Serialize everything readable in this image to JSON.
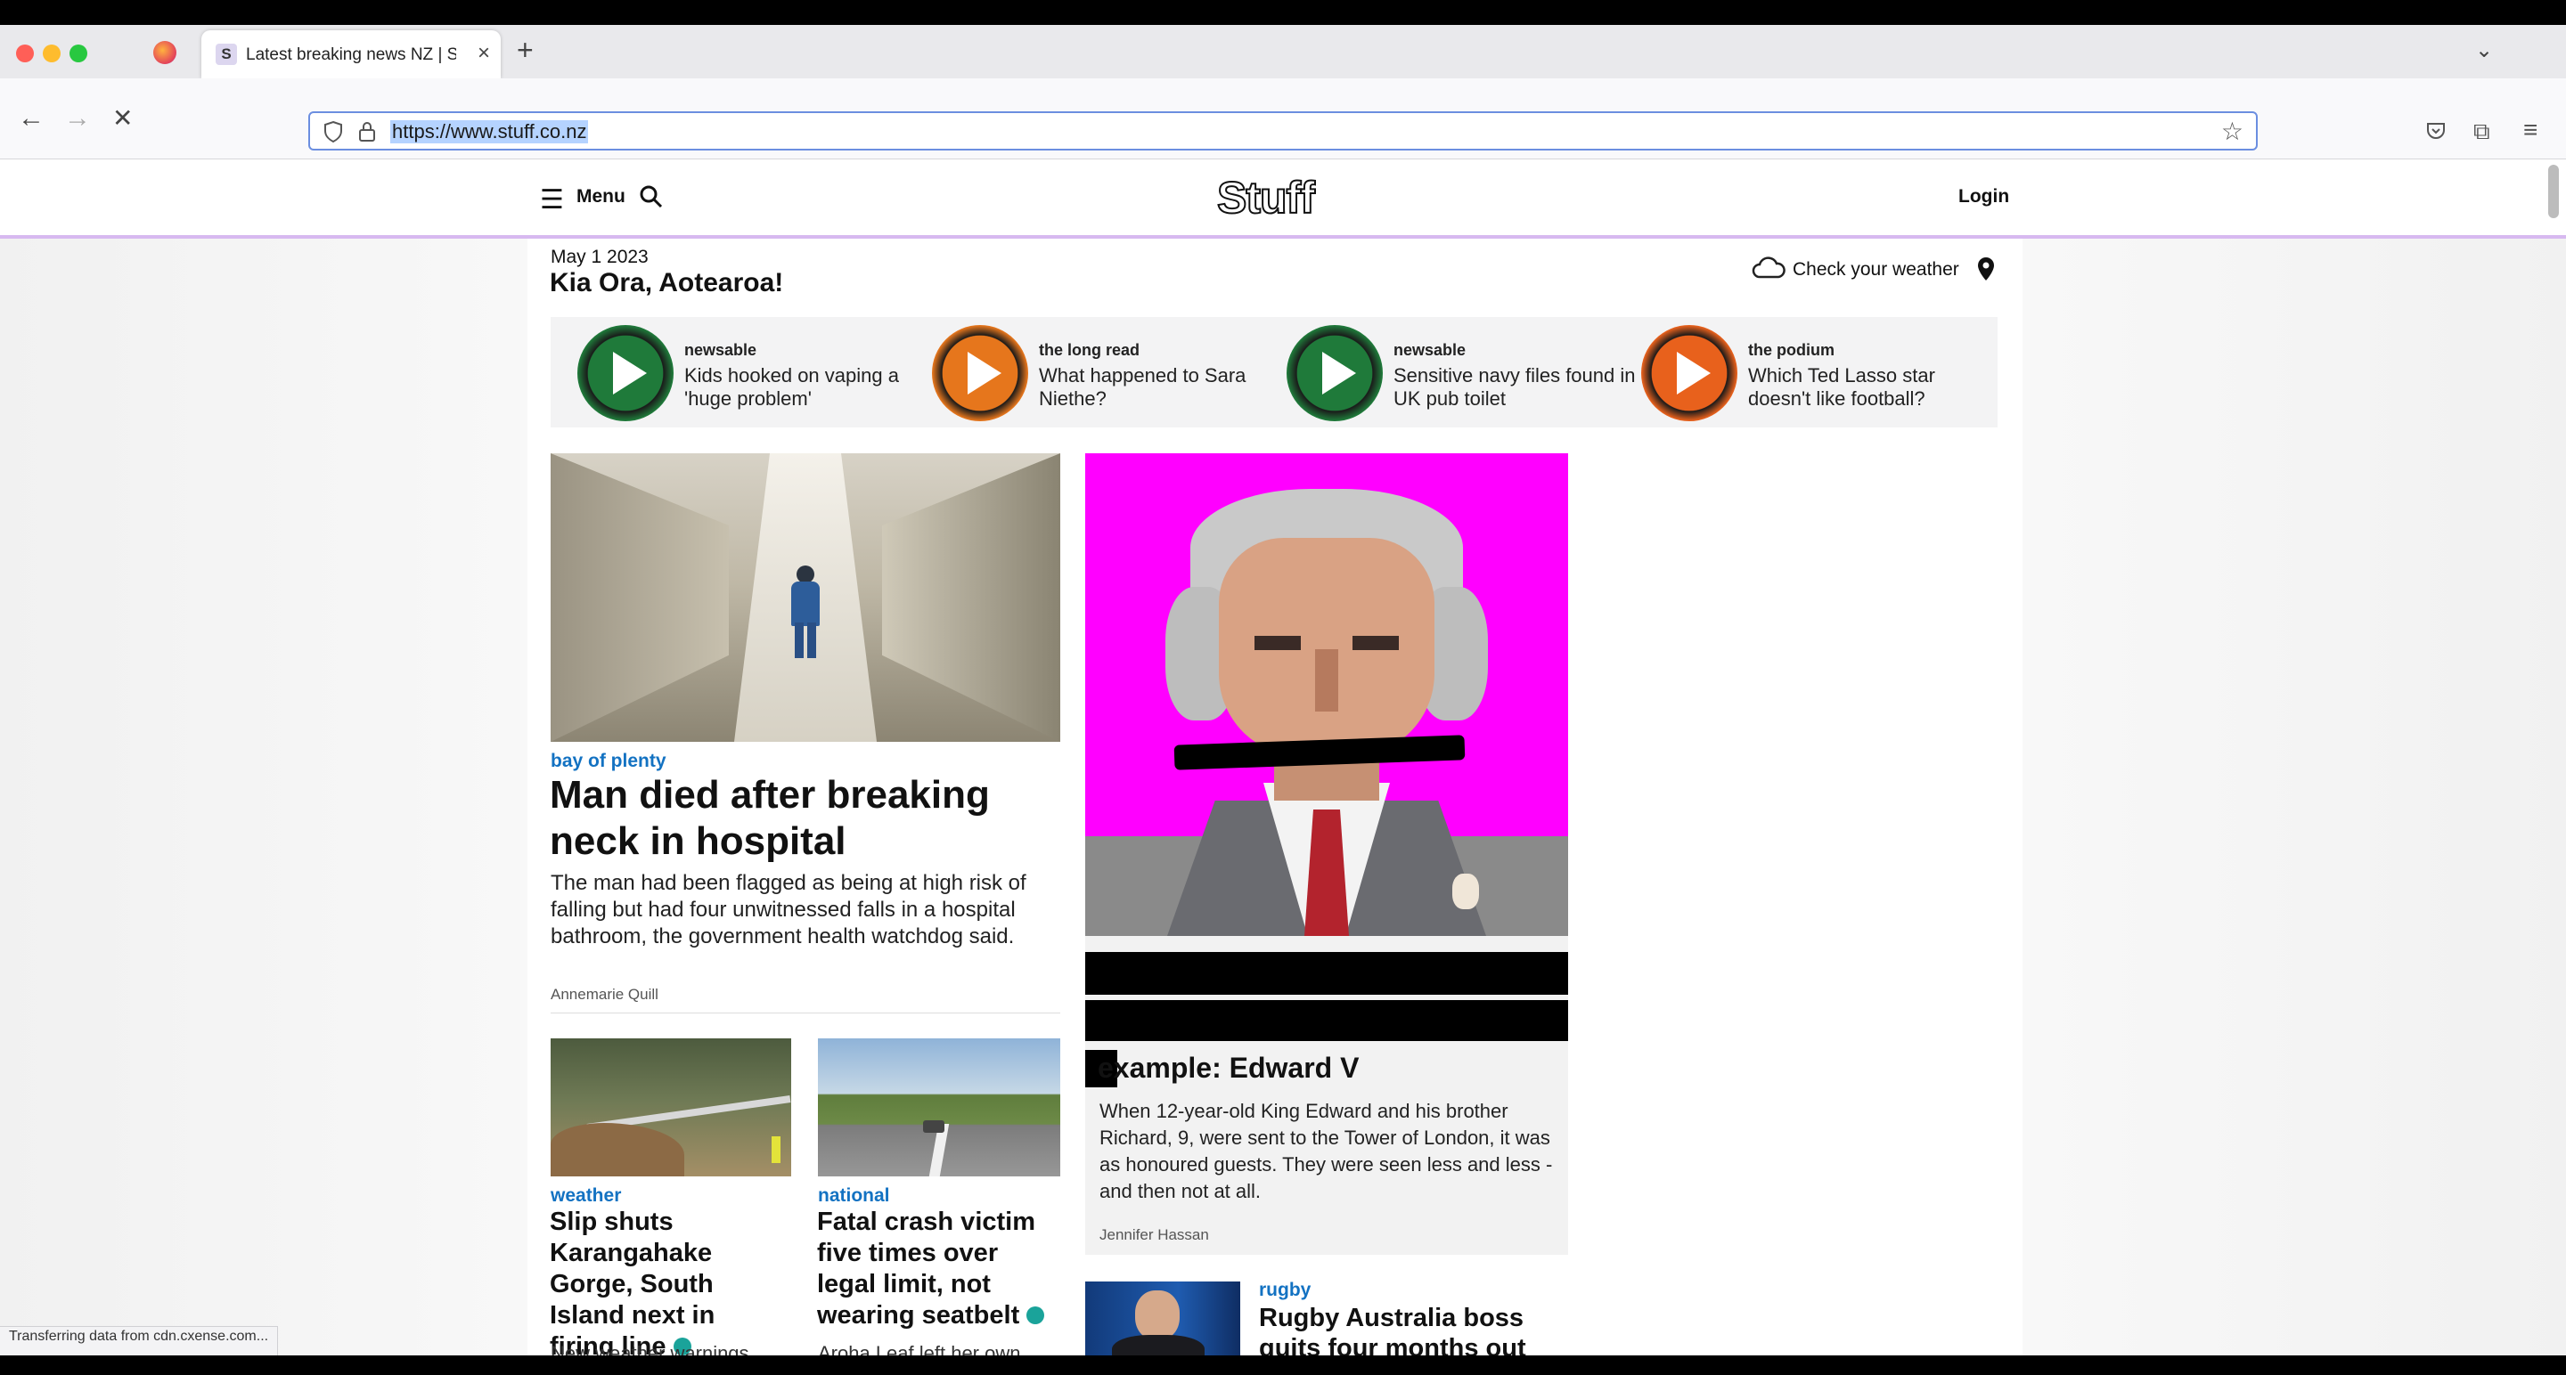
{
  "browser": {
    "tab_title": "Latest breaking news NZ | Stuff",
    "tab_favicon": "S",
    "url": "https://www.stuff.co.nz",
    "status_text": "Transferring data from cdn.cxense.com..."
  },
  "header": {
    "menu_label": "Menu",
    "logo": "Stuff",
    "login_label": "Login"
  },
  "greeting": {
    "date": "May 1 2023",
    "title": "Kia Ora, Aotearoa!",
    "weather_label": "Check your weather"
  },
  "podcasts": [
    {
      "brand": "newsable",
      "title": "Kids hooked on vaping a 'huge problem'",
      "color": "#1f7a3a"
    },
    {
      "brand": "the long read",
      "title": "What happened to Sara Niethe?",
      "color": "#e6761c"
    },
    {
      "brand": "newsable",
      "title": "Sensitive navy files found in UK pub toilet",
      "color": "#1f7a3a"
    },
    {
      "brand": "the podium",
      "title": "Which Ted Lasso star doesn't like football?",
      "color": "#e8611c"
    }
  ],
  "lead_story": {
    "kicker": "bay of plenty",
    "headline": "Man died after breaking neck in hospital",
    "summary": "The man had been flagged as being at high risk of falling but had four unwitnessed falls in a hospital bathroom, the government health watchdog said.",
    "byline": "Annemarie Quill"
  },
  "feature_story": {
    "headline_visible": "example: Edward V",
    "summary": "When 12-year-old King Edward and his brother Richard, 9, were sent to the Tower of London, it was as honoured guests. They were seen less and less - and then not at all.",
    "byline": "Jennifer Hassan",
    "bg_color": "#ff00ff"
  },
  "small_stories": [
    {
      "kicker": "weather",
      "headline": "Slip shuts Karangahake Gorge, South Island next in firing line",
      "teaser": "New weather warnings"
    },
    {
      "kicker": "national",
      "headline": "Fatal crash victim five times over legal limit, not wearing seatbelt",
      "teaser": "Aroha Leaf left her own"
    }
  ],
  "side_story": {
    "kicker": "rugby",
    "headline": "Rugby Australia boss quits four months out from World Cup"
  }
}
